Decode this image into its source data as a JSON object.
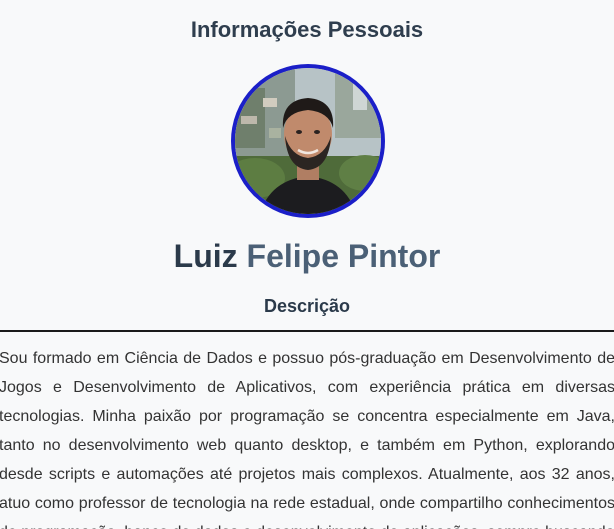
{
  "profile": {
    "section_title": "Informações Pessoais",
    "avatar_alt": "Foto de Luiz Felipe Pintor",
    "name_first": "Luiz",
    "name_rest": "Felipe Pintor",
    "description_title": "Descrição",
    "description_text": "Sou formado em Ciência de Dados e possuo pós-graduação em Desenvolvimento de Jogos e Desenvolvimento de Aplicativos, com experiência prática em diversas tecnologias. Minha paixão por programação se concentra especialmente em Java, tanto no desenvolvimento web quanto desktop, e também em Python, explorando desde scripts e automações até projetos mais complexos. Atualmente, aos 32 anos, atuo como professor de tecnologia na rede estadual, onde compartilho conhecimentos de programação, banco de dados e desenvolvimento de aplicações, sempre buscando"
  },
  "colors": {
    "avatar_border": "#1b1fc8",
    "name_first": "#2b3a4a",
    "name_rest": "#4b6076",
    "background": "#f8f9fa"
  }
}
